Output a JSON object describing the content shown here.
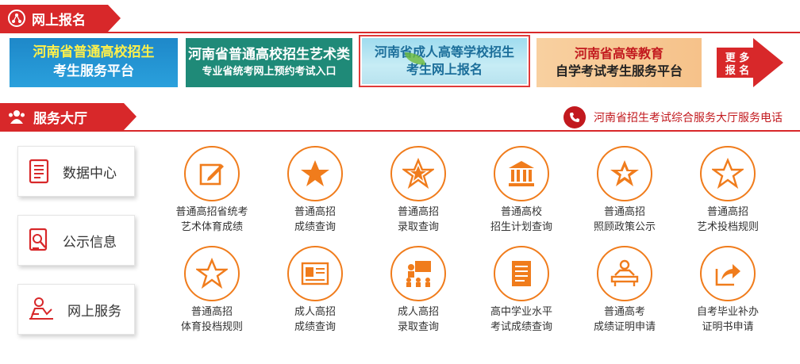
{
  "section1": {
    "title": "网上报名"
  },
  "banners": [
    {
      "line1": "河南省普通高校招生",
      "line2": "考生服务平台"
    },
    {
      "line1": "河南省普通高校招生艺术类",
      "line2": "专业省统考网上预约考试入口"
    },
    {
      "line1": "河南省成人高等学校招生",
      "line2": "考生网上报名"
    },
    {
      "line1": "河南省高等教育",
      "line2": "自学考试考生服务平台"
    }
  ],
  "more_banner": {
    "line1": "更 多",
    "line2": "报 名"
  },
  "section2": {
    "title": "服务大厅",
    "phone_text": "河南省招生考试综合服务大厅服务电话"
  },
  "side_menu": [
    {
      "label": "数据中心",
      "icon": "document-list-icon"
    },
    {
      "label": "公示信息",
      "icon": "search-document-icon"
    },
    {
      "label": "网上服务",
      "icon": "person-service-icon"
    }
  ],
  "services": [
    {
      "line1": "普通高招省统考",
      "line2": "艺术体育成绩",
      "icon": "edit-icon"
    },
    {
      "line1": "普通高招",
      "line2": "成绩查询",
      "icon": "star-icon"
    },
    {
      "line1": "普通高招",
      "line2": "录取查询",
      "icon": "star-outline-icon"
    },
    {
      "line1": "普通高校",
      "line2": "招生计划查询",
      "icon": "building-icon"
    },
    {
      "line1": "普通高招",
      "line2": "照顾政策公示",
      "icon": "star-badge-icon"
    },
    {
      "line1": "普通高招",
      "line2": "艺术投档规则",
      "icon": "star-outline-icon"
    },
    {
      "line1": "普通高招",
      "line2": "体育投档规则",
      "icon": "star-outline-icon"
    },
    {
      "line1": "成人高招",
      "line2": "成绩查询",
      "icon": "certificate-icon"
    },
    {
      "line1": "成人高招",
      "line2": "录取查询",
      "icon": "presentation-icon"
    },
    {
      "line1": "高中学业水平",
      "line2": "考试成绩查询",
      "icon": "document-icon"
    },
    {
      "line1": "普通高考",
      "line2": "成绩证明申请",
      "icon": "person-desk-icon"
    },
    {
      "line1": "自考毕业补办",
      "line2": "证明书申请",
      "icon": "share-arrow-icon"
    }
  ],
  "colors": {
    "accent_red": "#d8282a",
    "icon_orange": "#f07c1c"
  }
}
